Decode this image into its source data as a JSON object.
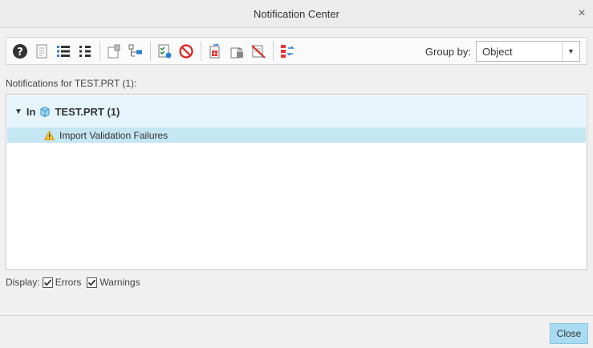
{
  "window": {
    "title": "Notification Center",
    "close_glyph": "×"
  },
  "toolbar": {
    "buttons": [
      {
        "name": "help-icon"
      },
      {
        "name": "report-icon"
      },
      {
        "name": "expand-all-icon"
      },
      {
        "name": "collapse-all-icon"
      },
      {
        "name": "new-window-icon"
      },
      {
        "name": "tree-icon"
      },
      {
        "name": "checklist-icon"
      },
      {
        "name": "cancel-icon"
      },
      {
        "name": "update-icon"
      },
      {
        "name": "lock-icon"
      },
      {
        "name": "clear-icon"
      },
      {
        "name": "sort-icon"
      }
    ],
    "group_by_label": "Group by:",
    "group_by_value": "Object"
  },
  "list": {
    "label": "Notifications for TEST.PRT (1):",
    "group": {
      "prefix": "In",
      "name": "TEST.PRT (1)"
    },
    "items": [
      {
        "label": "Import Validation Failures",
        "level": "warning"
      }
    ]
  },
  "display": {
    "label": "Display:",
    "errors_label": "Errors",
    "warnings_label": "Warnings",
    "errors_checked": true,
    "warnings_checked": true
  },
  "footer": {
    "close_label": "Close"
  },
  "colors": {
    "accent": "#a9dcf2",
    "row_selected": "#c5e6f3",
    "row_header": "#e6f5fb"
  }
}
